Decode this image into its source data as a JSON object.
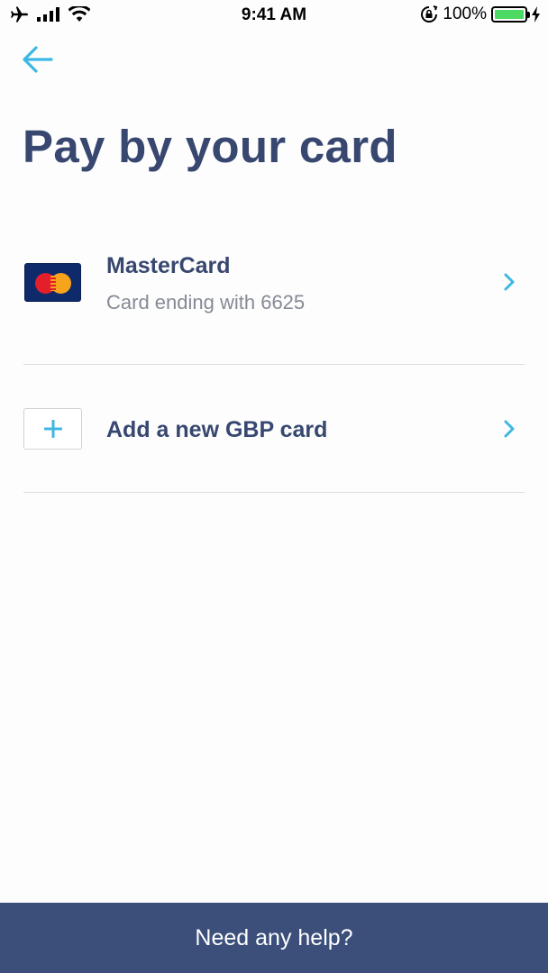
{
  "status_bar": {
    "time": "9:41 AM",
    "battery_percent": "100%",
    "icons": [
      "airplane-icon",
      "signal-icon",
      "wifi-icon",
      "rotation-lock-icon",
      "battery-icon",
      "charging-icon"
    ]
  },
  "header": {
    "back_icon": "arrow-left-icon",
    "title": "Pay by your card"
  },
  "cards": [
    {
      "brand_icon": "mastercard-logo-icon",
      "name": "MasterCard",
      "subtitle": "Card ending with 6625",
      "chevron_icon": "chevron-right-icon"
    }
  ],
  "add_card": {
    "icon": "plus-icon",
    "label": "Add a new GBP card",
    "chevron_icon": "chevron-right-icon"
  },
  "footer": {
    "help_label": "Need any help?"
  },
  "colors": {
    "accent": "#3db8e4",
    "title": "#37476f",
    "subtitle": "#858a94",
    "footer_bg": "#3b4f7a",
    "divider": "#dcdde0"
  }
}
